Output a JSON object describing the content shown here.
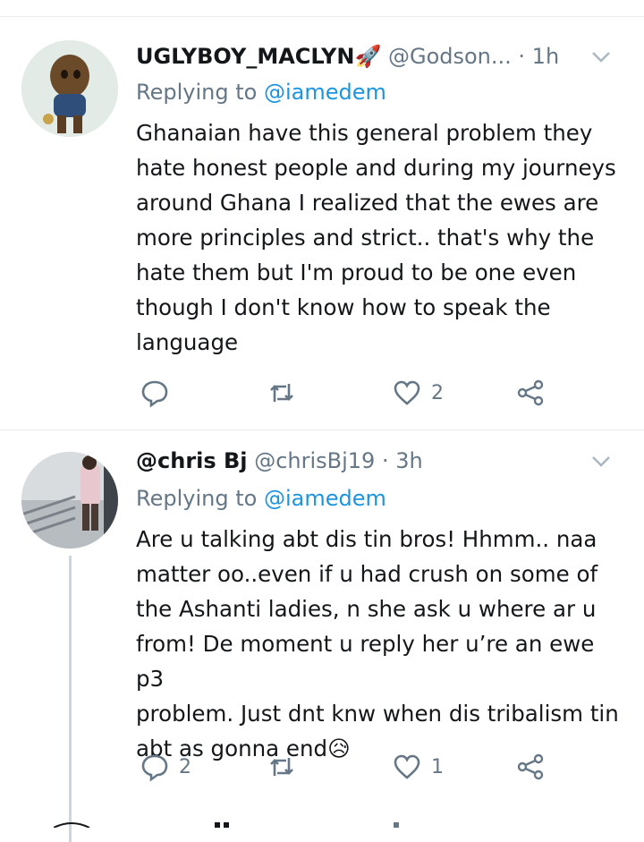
{
  "tweets": [
    {
      "name": "UGLYBOY_MACLYN",
      "name_emoji": "🚀",
      "handle": "@Godson...",
      "time": "· 1h",
      "replying_label": "Replying to",
      "replying_to": "@iamedem",
      "lines": [
        "Ghanaian have this general problem they",
        "hate honest people and during my journeys",
        "around Ghana I realized that the ewes are",
        "more principles and strict.. that's why the",
        "hate them but I'm proud to be one even",
        "though I don't know how to speak the",
        "language"
      ],
      "reply_count": "",
      "retweet_count": "",
      "like_count": "2"
    },
    {
      "name": "@chris Bj",
      "handle": "@chrisBj19",
      "time": "· 3h",
      "replying_label": "Replying to",
      "replying_to": "@iamedem",
      "lines": [
        "Are u  talking abt dis tin bros! Hhmm.. naa",
        "matter oo..even if u had crush on some of",
        "the Ashanti ladies, n she ask u where ar u",
        "from! De moment u reply her u’re an ewe p3",
        "problem. Just dnt knw when dis tribalism tin",
        "abt as gonna end"
      ],
      "end_emoji": "😥",
      "reply_count": "2",
      "retweet_count": "",
      "like_count": "1"
    }
  ],
  "colors": {
    "text": "#14171a",
    "secondary": "#657786",
    "link": "#1b95e0",
    "divider": "#e6ecf0"
  },
  "icons": [
    "chevron-down-icon",
    "reply-icon",
    "retweet-icon",
    "like-icon",
    "share-icon"
  ]
}
